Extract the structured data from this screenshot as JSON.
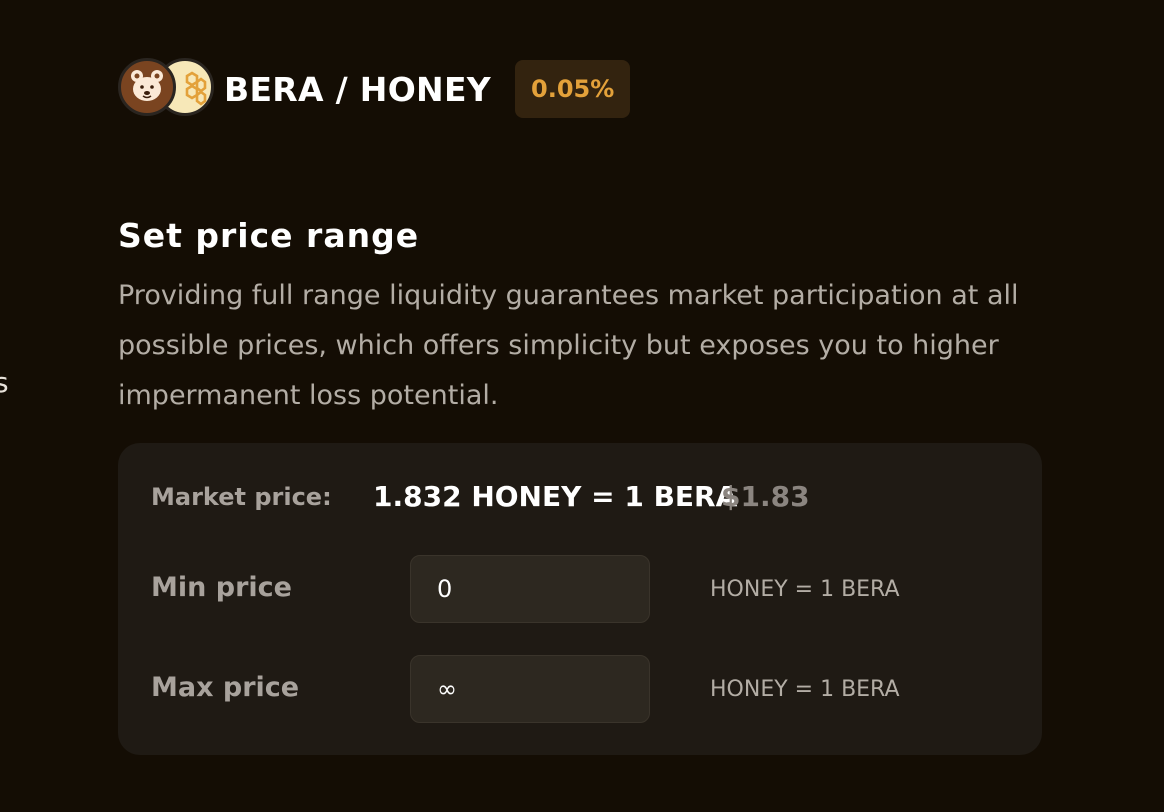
{
  "edge_text": "s",
  "pair": {
    "name": "BERA / HONEY",
    "fee": "0.05%",
    "tokens": [
      {
        "symbol": "BERA",
        "icon": "bear-face-icon",
        "color": "#7a4420"
      },
      {
        "symbol": "HONEY",
        "icon": "honeycomb-icon",
        "color": "#f7e8b8"
      }
    ]
  },
  "price_range": {
    "title": "Set price range",
    "description": "Providing full range liquidity guarantees market participation at all possible prices, which offers simplicity but exposes you to higher impermanent loss potential.",
    "market_price_label": "Market price:",
    "market_price_value": "1.832 HONEY = 1 BERA",
    "market_price_usd": "$1.83",
    "min": {
      "label": "Min price",
      "value": "0",
      "unit": "HONEY = 1 BERA"
    },
    "max": {
      "label": "Max price",
      "value": "∞",
      "unit": "HONEY = 1 BERA"
    }
  },
  "colors": {
    "background": "#140d04",
    "card": "#1f1a14",
    "input": "#2d2820",
    "fee_badge_bg": "#33230f",
    "fee_badge_text": "#e3a13a"
  }
}
